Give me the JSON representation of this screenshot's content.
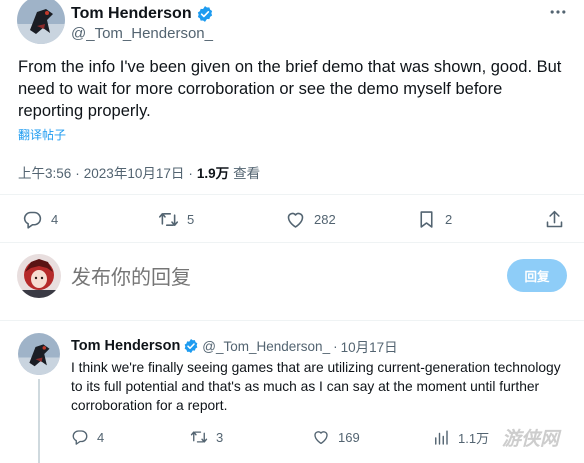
{
  "main_tweet": {
    "author_name": "Tom Henderson",
    "handle": "@_Tom_Henderson_",
    "text": "From the info I've been given on the brief demo that was shown, good. But need to wait for more corroboration or see the demo myself before reporting properly.",
    "translate_label": "翻译帖子",
    "time": "上午3:56",
    "sep": "·",
    "date": "2023年10月17日",
    "views_count": "1.9万",
    "views_label": "查看",
    "replies": "4",
    "retweets": "5",
    "likes": "282",
    "bookmarks": "2"
  },
  "reply_composer": {
    "placeholder": "发布你的回复",
    "button_label": "回复"
  },
  "reply_tweet": {
    "author_name": "Tom Henderson",
    "handle": "@_Tom_Henderson_",
    "sep": "·",
    "date": "10月17日",
    "text": "I think we're finally seeing games that are utilizing current-generation technology to its full potential and that's as much as I can say at the moment until further corroboration for a report.",
    "replies": "4",
    "retweets": "3",
    "likes": "169",
    "views": "1.1万"
  },
  "watermark": "游侠网",
  "colors": {
    "accent": "#1d9bf0",
    "accent_disabled": "#8ecdf8",
    "text_primary": "#0f1419",
    "text_secondary": "#536471",
    "divider": "#eff3f4"
  },
  "icons": [
    "more-icon",
    "verified-icon",
    "reply-icon",
    "retweet-icon",
    "like-icon",
    "bookmark-icon",
    "share-icon",
    "views-icon"
  ]
}
